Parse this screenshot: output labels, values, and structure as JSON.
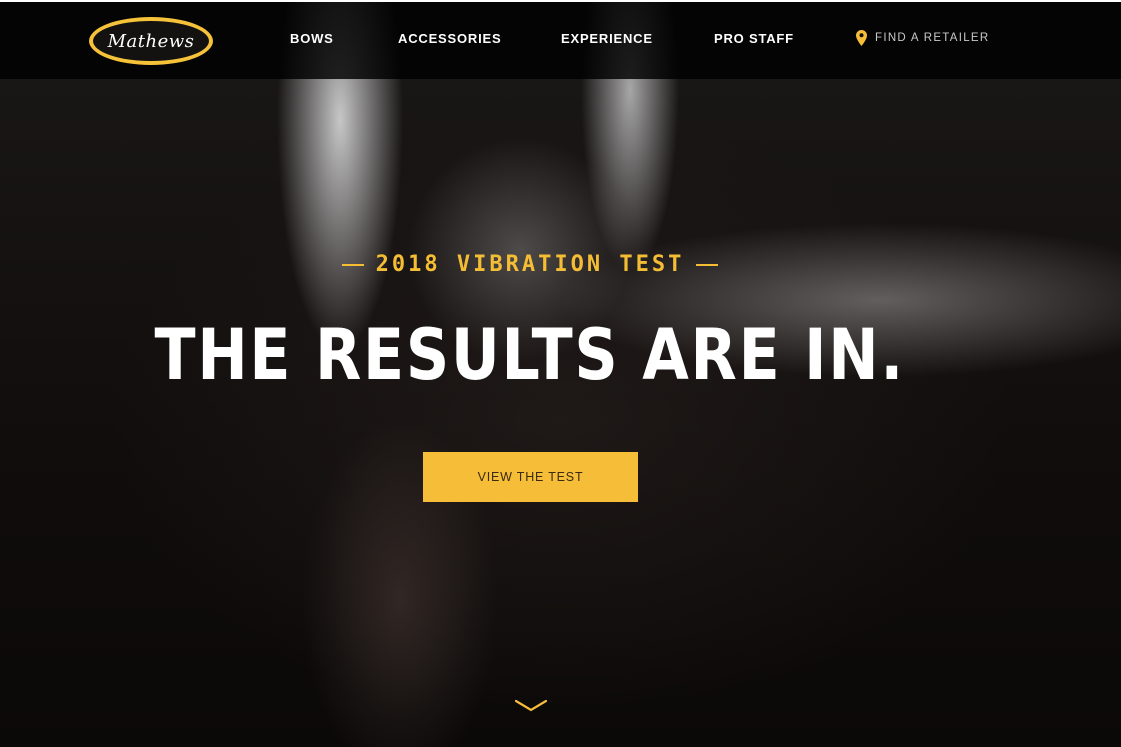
{
  "brand": {
    "logo_text": "Mathews",
    "accent_color": "#f6bd39"
  },
  "nav": {
    "items": [
      {
        "label": "BOWS"
      },
      {
        "label": "ACCESSORIES"
      },
      {
        "label": "EXPERIENCE"
      },
      {
        "label": "PRO STAFF"
      }
    ],
    "retailer": {
      "label": "FIND A RETAILER",
      "icon": "map-pin-icon"
    }
  },
  "hero": {
    "eyebrow": "2018 VIBRATION TEST",
    "headline": "THE RESULTS ARE IN.",
    "cta_label": "VIEW THE TEST",
    "scroll_icon": "chevron-down-icon"
  }
}
